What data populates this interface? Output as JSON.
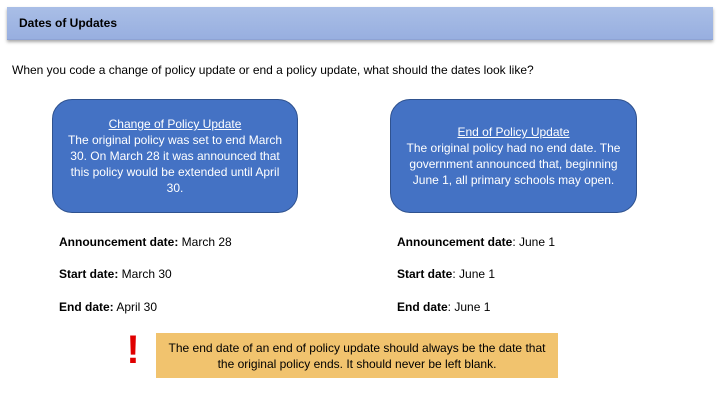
{
  "slide": {
    "title": "Dates of Updates",
    "question": "When you code a change of policy update or end a policy update, what should the dates look like?"
  },
  "left_box": {
    "heading": "Change of Policy Update",
    "body": "The original policy was set to end March 30. On March 28 it was announced that this policy would be extended until April 30."
  },
  "right_box": {
    "heading": "End of Policy Update",
    "body": "The original policy had no end date. The government announced that, beginning June 1, all primary schools may open."
  },
  "left_dates": {
    "announcement_label": "Announcement date:",
    "announcement_value": " March 28",
    "start_label": "Start date:",
    "start_value": " March 30",
    "end_label": "End date:",
    "end_value": " April 30"
  },
  "right_dates": {
    "announcement_label": "Announcement date",
    "announcement_value": ": June 1",
    "start_label": "Start date",
    "start_value": ": June 1",
    "end_label": "End date",
    "end_value": ": June 1"
  },
  "note": {
    "text": "The end date of an end of policy update should always be the date that the original policy ends. It should never be left blank.",
    "symbol": "!"
  },
  "colors": {
    "title_bar": "#a9bee6",
    "box_fill": "#4472c4",
    "note_fill": "#f1c36e",
    "exclamation": "#e00000"
  }
}
